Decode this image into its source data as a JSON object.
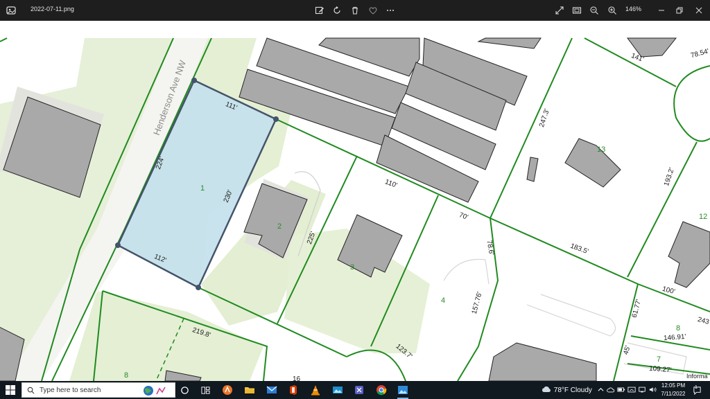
{
  "window": {
    "filename": "2022-07-11.png",
    "zoom": "146%"
  },
  "map": {
    "street_name": "Henderson Ave NW",
    "selected_parcel": {
      "number": "1",
      "fill": "#c3e0ec",
      "stroke": "#44546a",
      "dims": {
        "top": "111'",
        "left": "224'",
        "right": "230'",
        "bottom": "112'"
      }
    },
    "lot_numbers": [
      "2",
      "3",
      "4",
      "13",
      "12",
      "8",
      "7",
      "8"
    ],
    "dimensions": [
      "225'",
      "110'",
      "70'",
      "78.6'",
      "157.76'",
      "183.5'",
      "247.3'",
      "141'",
      "78.54'",
      "193.2'",
      "100'",
      "61.77'",
      "243",
      "146.91'",
      "45'",
      "109.27'",
      "219.8'",
      "123.7'",
      "16"
    ],
    "partial_label": "Informa",
    "colors": {
      "parcel_line": "#1f8a1f",
      "building": "#a9a9a9",
      "building_shadow": "#e3e3de",
      "vegetation": "#e4efd4"
    }
  },
  "taskbar": {
    "search_placeholder": "Type here to search",
    "weather": "78°F  Cloudy",
    "time": "12:05 PM",
    "date": "7/11/2022",
    "notification_count": "1"
  }
}
